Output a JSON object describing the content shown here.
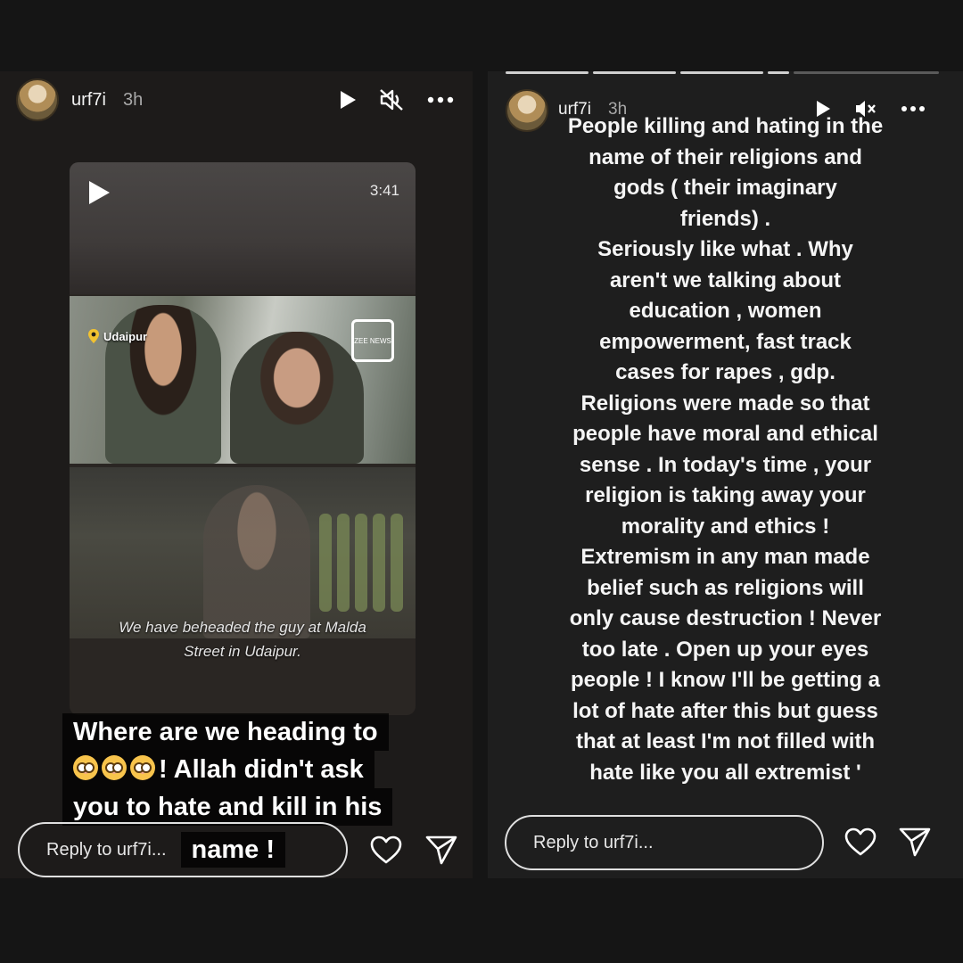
{
  "left_story": {
    "username": "urf7i",
    "timestamp": "3h",
    "video": {
      "duration": "3:41",
      "location": "Udaipur",
      "logo_text": "ZEE NEWS",
      "caption_line1": "We have beheaded the guy at Malda",
      "caption_line2": "Street in Udaipur."
    },
    "overlay_lines": [
      "Where are we heading to",
      "! Allah didn't ask",
      "you to hate and kill in his",
      "name !"
    ],
    "reply_placeholder": "Reply to urf7i..."
  },
  "right_story": {
    "username": "urf7i",
    "timestamp": "3h",
    "progress_segments": 5,
    "text_lines": [
      "People killing and hating in the",
      "name of their religions and",
      "gods ( their imaginary",
      "friends) .",
      "Seriously like what . Why",
      "aren't we talking about",
      "education , women",
      "empowerment, fast track",
      "cases for rapes , gdp.",
      "Religions were made so that",
      "people have moral and ethical",
      "sense . In today's time , your",
      "religion is  taking away your",
      "morality and ethics !",
      "Extremism in any man made",
      "belief such as religions will",
      "only cause destruction ! Never",
      "too late . Open up your eyes",
      "people ! I know I'll be getting a",
      "lot of hate after this but guess",
      "that at least I'm not filled with",
      "hate like you all extremist '"
    ],
    "reply_placeholder": "Reply to urf7i..."
  },
  "icons": {
    "play": "play-icon",
    "mute": "muted-speaker-icon",
    "more": "more-icon",
    "like": "heart-icon",
    "send": "send-icon",
    "location": "location-pin-icon"
  }
}
